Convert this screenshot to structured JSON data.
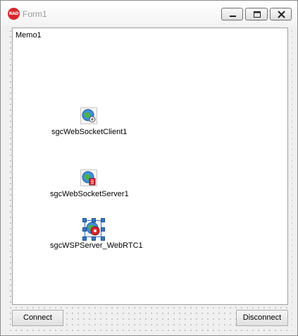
{
  "window": {
    "title": "Form1",
    "logo_text": "RAD",
    "accent": "#d8262b"
  },
  "memo": {
    "text": "Memo1"
  },
  "components": [
    {
      "label": "sgcWebSocketClient1",
      "icon": "websocket-client-icon"
    },
    {
      "label": "sgcWebSocketServer1",
      "icon": "websocket-server-icon"
    },
    {
      "label": "sgcWSPServer_WebRTC1",
      "icon": "webrtc-server-icon",
      "selected": true
    }
  ],
  "buttons": {
    "connect": "Connect",
    "disconnect": "Disconnect"
  }
}
